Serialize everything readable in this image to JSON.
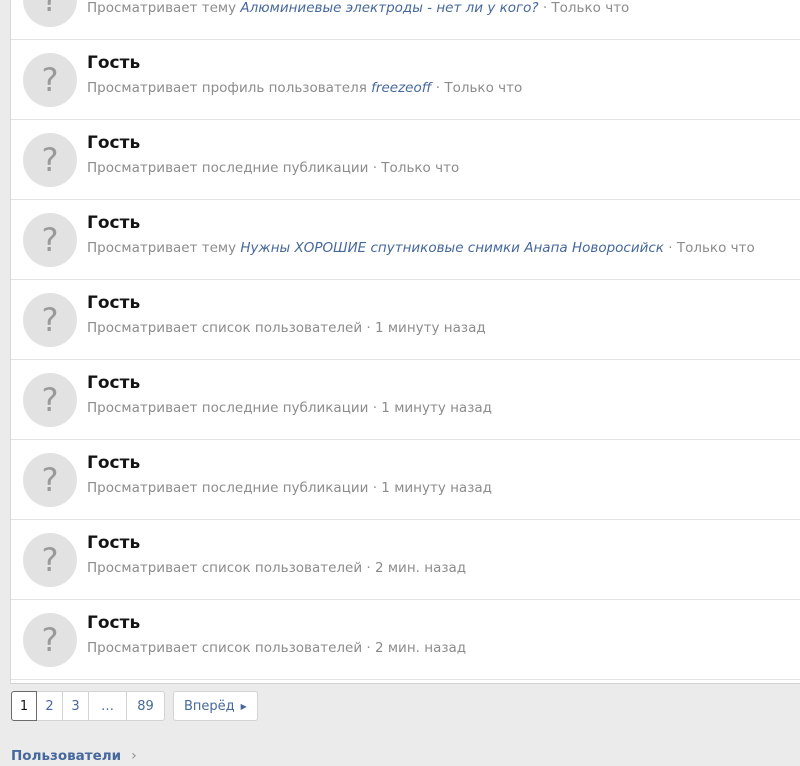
{
  "rows": [
    {
      "name": "",
      "before": "Просматривает тему ",
      "target": "Алюминиевые электроды - нет ли у кого?",
      "after": " · Только что"
    },
    {
      "name": "Гость",
      "before": "Просматривает профиль пользователя ",
      "target": "freezeoff",
      "after": " · Только что"
    },
    {
      "name": "Гость",
      "before": "Просматривает последние публикации · Только что",
      "target": "",
      "after": ""
    },
    {
      "name": "Гость",
      "before": "Просматривает тему ",
      "target": "Нужны ХОРОШИЕ спутниковые снимки Анапа Новоросийск",
      "after": " · Только что"
    },
    {
      "name": "Гость",
      "before": "Просматривает список пользователей · 1 минуту назад",
      "target": "",
      "after": ""
    },
    {
      "name": "Гость",
      "before": "Просматривает последние публикации · 1 минуту назад",
      "target": "",
      "after": ""
    },
    {
      "name": "Гость",
      "before": "Просматривает последние публикации · 1 минуту назад",
      "target": "",
      "after": ""
    },
    {
      "name": "Гость",
      "before": "Просматривает список пользователей · 2 мин. назад",
      "target": "",
      "after": ""
    },
    {
      "name": "Гость",
      "before": "Просматривает список пользователей · 2 мин. назад",
      "target": "",
      "after": ""
    }
  ],
  "avatar_glyph": "?",
  "avatar_icon": "question-mark-icon",
  "pagination": {
    "pages": [
      "1",
      "2",
      "3",
      "…",
      "89"
    ],
    "current": "1",
    "next_label": "Вперёд",
    "next_icon": "caret-right-icon"
  },
  "breadcrumb": {
    "label": "Пользователи",
    "icon": "chevron-right-icon"
  },
  "colors": {
    "link": "#47689c",
    "muted": "#8c8c8c",
    "avatar_bg": "#e2e2e2",
    "page_bg": "#ebebeb"
  }
}
